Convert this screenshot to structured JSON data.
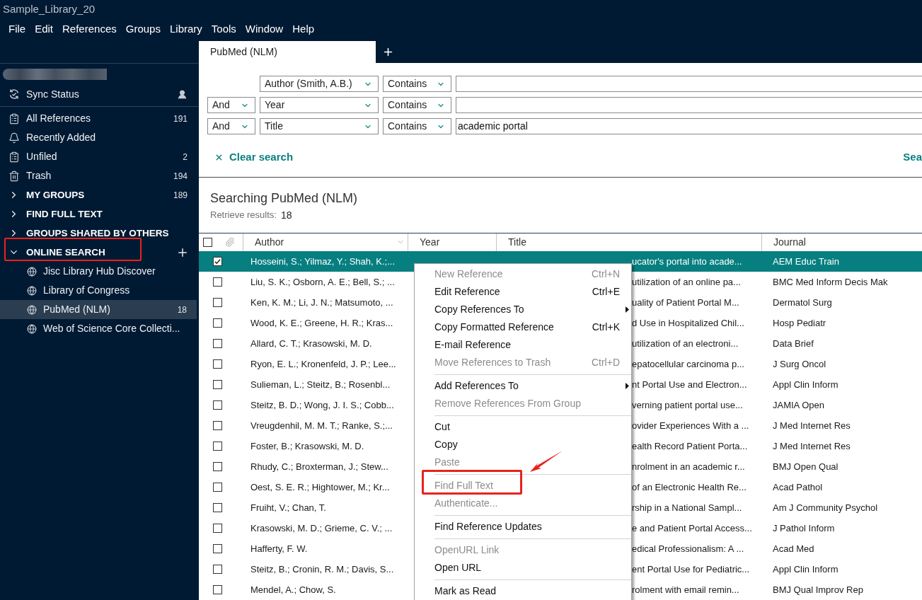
{
  "window": {
    "title": "Sample_Library_20"
  },
  "menu_bar": [
    "File",
    "Edit",
    "References",
    "Groups",
    "Library",
    "Tools",
    "Window",
    "Help"
  ],
  "sidebar": {
    "sync_label": "Sync Status",
    "items": [
      {
        "kind": "clipboard",
        "label": "All References",
        "count": "191"
      },
      {
        "kind": "bell",
        "label": "Recently Added"
      },
      {
        "kind": "clipboard",
        "label": "Unfiled",
        "count": "2"
      },
      {
        "kind": "trash",
        "label": "Trash",
        "count": "194"
      }
    ],
    "sections": [
      {
        "label": "MY GROUPS",
        "count": "189",
        "expanded": false,
        "annotated": false,
        "add_button": false
      },
      {
        "label": "FIND FULL TEXT",
        "expanded": false,
        "annotated": false,
        "add_button": false
      },
      {
        "label": "GROUPS SHARED BY OTHERS",
        "expanded": false,
        "annotated": false,
        "add_button": false
      },
      {
        "label": "ONLINE SEARCH",
        "expanded": true,
        "annotated": true,
        "add_button": true,
        "children": [
          {
            "label": "Jisc Library Hub Discover",
            "selected": false
          },
          {
            "label": "Library of Congress",
            "selected": false
          },
          {
            "label": "PubMed (NLM)",
            "count": "18",
            "selected": true
          },
          {
            "label": "Web of Science Core Collecti...",
            "selected": false
          }
        ]
      }
    ]
  },
  "tabs": [
    {
      "label": "PubMed (NLM)",
      "selected": true
    }
  ],
  "search": {
    "rows": [
      {
        "field": "Author (Smith, A.B.)",
        "operator": "Contains"
      },
      {
        "connector": "And",
        "field": "Year",
        "operator": "Contains"
      },
      {
        "connector": "And",
        "field": "Title",
        "operator": "Contains",
        "value": "academic portal"
      }
    ],
    "clear_label": "Clear search",
    "search_label": "Sea"
  },
  "results": {
    "heading": "Searching PubMed (NLM)",
    "count_label": "Retrieve results:",
    "count": "18"
  },
  "table": {
    "all_checked": false,
    "columns": [
      "Author",
      "Year",
      "Title",
      "Journal"
    ],
    "rows": [
      {
        "checked": true,
        "selected": true,
        "author": "Hosseini, S.; Yilmaz, Y.; Shah, K.;...",
        "title": "ucator's portal into acade...",
        "journal": "AEM Educ Train"
      },
      {
        "checked": false,
        "selected": false,
        "author": "Liu, S. K.; Osborn, A. E.; Bell, S.; ...",
        "title": "utilization of an online pa...",
        "journal": "BMC Med Inform Decis Mak"
      },
      {
        "checked": false,
        "selected": false,
        "author": "Ken, K. M.; Li, J. N.; Matsumoto, ...",
        "title": "uality of Patient Portal M...",
        "journal": "Dermatol Surg"
      },
      {
        "checked": false,
        "selected": false,
        "author": "Wood, K. E.; Greene, H. R.; Kras...",
        "title": "d Use in Hospitalized Chil...",
        "journal": "Hosp Pediatr"
      },
      {
        "checked": false,
        "selected": false,
        "author": "Allard, C. T.; Krasowski, M. D.",
        "title": "utilization of an electroni...",
        "journal": "Data Brief"
      },
      {
        "checked": false,
        "selected": false,
        "author": "Ryon, E. L.; Kronenfeld, J. P.; Lee...",
        "title": "epatocellular carcinoma p...",
        "journal": "J Surg Oncol"
      },
      {
        "checked": false,
        "selected": false,
        "author": "Sulieman, L.; Steitz, B.; Rosenbl...",
        "title": "nt Portal Use and Electron...",
        "journal": "Appl Clin Inform"
      },
      {
        "checked": false,
        "selected": false,
        "author": "Steitz, B. D.; Wong, J. I. S.; Cobb...",
        "title": "verning patient portal use...",
        "journal": "JAMIA Open"
      },
      {
        "checked": false,
        "selected": false,
        "author": "Vreugdenhil, M. M. T.; Ranke, S.;...",
        "title": "ovider Experiences With a ...",
        "journal": "J Med Internet Res"
      },
      {
        "checked": false,
        "selected": false,
        "author": "Foster, B.; Krasowski, M. D.",
        "title": "ealth Record Patient Porta...",
        "journal": "J Med Internet Res"
      },
      {
        "checked": false,
        "selected": false,
        "author": "Rhudy, C.; Broxterman, J.; Stew...",
        "title": "nrolment in an academic r...",
        "journal": "BMJ Open Qual"
      },
      {
        "checked": false,
        "selected": false,
        "author": "Oest, S. E. R.; Hightower, M.; Kr...",
        "title": "of an Electronic Health Re...",
        "journal": "Acad Pathol"
      },
      {
        "checked": false,
        "selected": false,
        "author": "Fruiht, V.; Chan, T.",
        "title": "rship in a National Sampl...",
        "journal": "Am J Community Psychol"
      },
      {
        "checked": false,
        "selected": false,
        "author": "Krasowski, M. D.; Grieme, C. V.; ...",
        "title": "e and Patient Portal Access...",
        "journal": "J Pathol Inform"
      },
      {
        "checked": false,
        "selected": false,
        "author": "Hafferty, F. W.",
        "title": "edical Professionalism: A ...",
        "journal": "Acad Med"
      },
      {
        "checked": false,
        "selected": false,
        "author": "Steitz, B.; Cronin, R. M.; Davis, S...",
        "title": "ent Portal Use for Pediatric...",
        "journal": "Appl Clin Inform"
      },
      {
        "checked": false,
        "selected": false,
        "author": "Mendel, A.; Chow, S.",
        "title": "rolment with email remin...",
        "journal": "BMJ Qual Improv Rep"
      }
    ]
  },
  "context_menu": {
    "items": [
      {
        "kind": "item",
        "label": "New Reference",
        "shortcut": "Ctrl+N",
        "disabled": true,
        "submenu": false,
        "annotated": false
      },
      {
        "kind": "item",
        "label": "Edit Reference",
        "shortcut": "Ctrl+E",
        "disabled": false,
        "submenu": false,
        "annotated": false
      },
      {
        "kind": "item",
        "label": "Copy References To",
        "disabled": false,
        "submenu": true,
        "annotated": false
      },
      {
        "kind": "item",
        "label": "Copy Formatted Reference",
        "shortcut": "Ctrl+K",
        "disabled": false,
        "submenu": false,
        "annotated": false
      },
      {
        "kind": "item",
        "label": "E-mail Reference",
        "disabled": false,
        "submenu": false,
        "annotated": false
      },
      {
        "kind": "item",
        "label": "Move References to Trash",
        "shortcut": "Ctrl+D",
        "disabled": true,
        "submenu": false,
        "annotated": false
      },
      {
        "kind": "separator"
      },
      {
        "kind": "item",
        "label": "Add References To",
        "disabled": false,
        "submenu": true,
        "annotated": false
      },
      {
        "kind": "item",
        "label": "Remove References From Group",
        "disabled": true,
        "submenu": false,
        "annotated": false
      },
      {
        "kind": "separator"
      },
      {
        "kind": "item",
        "label": "Cut",
        "disabled": false,
        "submenu": false,
        "annotated": false
      },
      {
        "kind": "item",
        "label": "Copy",
        "disabled": false,
        "submenu": false,
        "annotated": false
      },
      {
        "kind": "item",
        "label": "Paste",
        "disabled": true,
        "submenu": false,
        "annotated": false
      },
      {
        "kind": "separator"
      },
      {
        "kind": "item",
        "label": "Find Full Text",
        "disabled": true,
        "submenu": false,
        "annotated": true
      },
      {
        "kind": "item",
        "label": "Authenticate...",
        "disabled": true,
        "submenu": false,
        "annotated": false
      },
      {
        "kind": "separator"
      },
      {
        "kind": "item",
        "label": "Find Reference Updates",
        "disabled": false,
        "submenu": false,
        "annotated": false
      },
      {
        "kind": "separator"
      },
      {
        "kind": "item",
        "label": "OpenURL Link",
        "disabled": true,
        "submenu": false,
        "annotated": false
      },
      {
        "kind": "item",
        "label": "Open URL",
        "disabled": false,
        "submenu": false,
        "annotated": false
      },
      {
        "kind": "separator"
      },
      {
        "kind": "item",
        "label": "Mark as Read",
        "disabled": false,
        "submenu": false,
        "annotated": false
      }
    ]
  }
}
